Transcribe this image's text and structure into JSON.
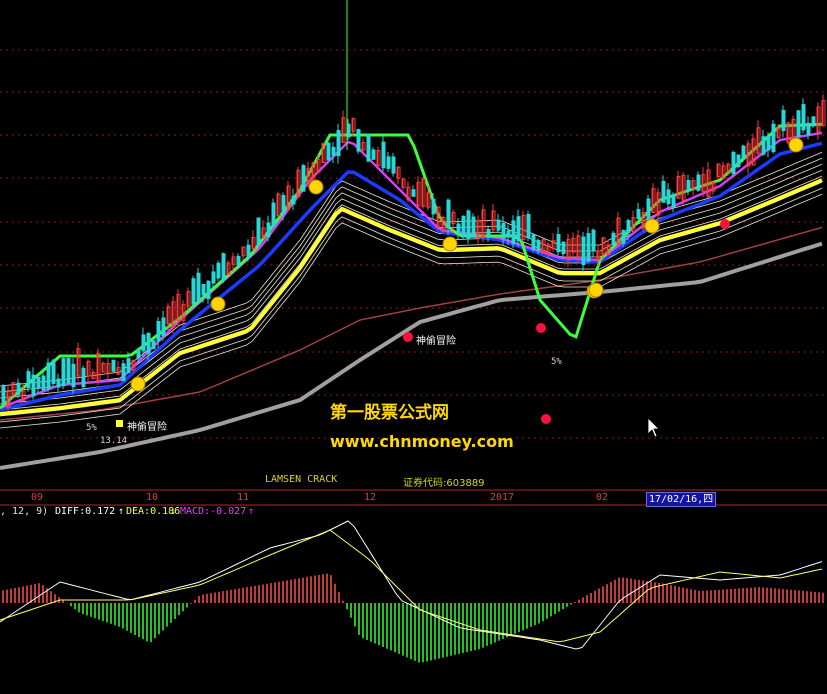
{
  "chart_data": [
    {
      "type": "line",
      "panel": "price",
      "series": [],
      "markers": [
        {
          "kind": "smiley",
          "count": 8,
          "color": "#ffd400"
        },
        {
          "kind": "red-dot",
          "count": 4,
          "color": "#ff1040"
        }
      ],
      "annotations": {
        "signal_1": "神偷冒险",
        "signal_2": "神偷冒险",
        "pct_1": "5%",
        "pct_2": "5%",
        "low_value": "13.14"
      },
      "grid": true,
      "colors": {
        "candle_up": "#ff3c3c",
        "candle_down": "#28d8d8",
        "band_green": "#3cff3c",
        "band_yellow": "#ffff33",
        "band_blue": "#1a3cff",
        "band_magenta": "#d040ff",
        "long_ma_gray": "#a0a0a0",
        "long_ma_brown": "#a04040"
      }
    },
    {
      "type": "line",
      "panel": "MACD",
      "series": [
        {
          "name": "DIFF",
          "value": 0.172
        },
        {
          "name": "DEA",
          "value": 0.186
        },
        {
          "name": "MACD",
          "value": -0.027
        }
      ],
      "colors": {
        "hist_pos": "#ff5050",
        "hist_neg": "#33ff33"
      },
      "grid": false
    }
  ],
  "watermark": {
    "cn": "第一股票公式网",
    "url": "www.chnmoney.com"
  },
  "credit": "LAMSEN  CRACK",
  "code_label": "证券代码:603889",
  "axis": {
    "ticks": [
      "09",
      "10",
      "11",
      "12",
      "2017",
      "02"
    ],
    "cursor_date": "17/02/16,四"
  },
  "indicator": {
    "prefix": ", 12, 9)",
    "diff_text": "DIFF:0.172",
    "dea_text": "DEA:0.186",
    "macd_text": "MACD:-0.027",
    "up_arrow": "↑",
    "down_arrow": "↓"
  }
}
